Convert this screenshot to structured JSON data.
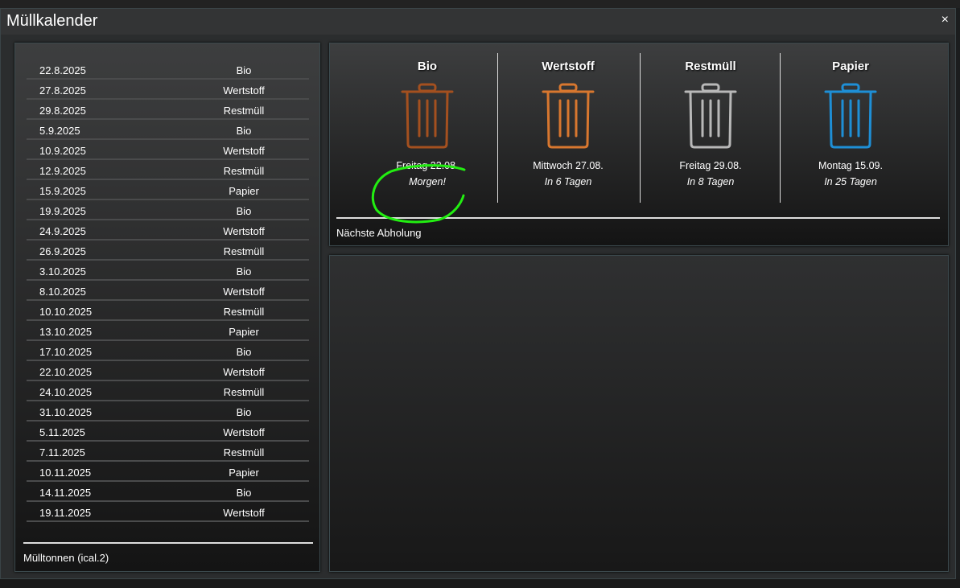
{
  "dialog": {
    "title": "Müllkalender",
    "close_label": "×"
  },
  "list": {
    "rows": [
      {
        "date": "22.8.2025",
        "type": "Bio"
      },
      {
        "date": "27.8.2025",
        "type": "Wertstoff"
      },
      {
        "date": "29.8.2025",
        "type": "Restmüll"
      },
      {
        "date": "5.9.2025",
        "type": "Bio"
      },
      {
        "date": "10.9.2025",
        "type": "Wertstoff"
      },
      {
        "date": "12.9.2025",
        "type": "Restmüll"
      },
      {
        "date": "15.9.2025",
        "type": "Papier"
      },
      {
        "date": "19.9.2025",
        "type": "Bio"
      },
      {
        "date": "24.9.2025",
        "type": "Wertstoff"
      },
      {
        "date": "26.9.2025",
        "type": "Restmüll"
      },
      {
        "date": "3.10.2025",
        "type": "Bio"
      },
      {
        "date": "8.10.2025",
        "type": "Wertstoff"
      },
      {
        "date": "10.10.2025",
        "type": "Restmüll"
      },
      {
        "date": "13.10.2025",
        "type": "Papier"
      },
      {
        "date": "17.10.2025",
        "type": "Bio"
      },
      {
        "date": "22.10.2025",
        "type": "Wertstoff"
      },
      {
        "date": "24.10.2025",
        "type": "Restmüll"
      },
      {
        "date": "31.10.2025",
        "type": "Bio"
      },
      {
        "date": "5.11.2025",
        "type": "Wertstoff"
      },
      {
        "date": "7.11.2025",
        "type": "Restmüll"
      },
      {
        "date": "10.11.2025",
        "type": "Papier"
      },
      {
        "date": "14.11.2025",
        "type": "Bio"
      },
      {
        "date": "19.11.2025",
        "type": "Wertstoff"
      }
    ],
    "footer": "Mülltonnen (ical.2)"
  },
  "next": {
    "bins": [
      {
        "name": "Bio",
        "date": "Freitag 22.08.",
        "relative": "Morgen!",
        "color": "#a4501f",
        "icon": "trash-bin-icon"
      },
      {
        "name": "Wertstoff",
        "date": "Mittwoch 27.08.",
        "relative": "In 6 Tagen",
        "color": "#d8772f",
        "icon": "trash-bin-icon"
      },
      {
        "name": "Restmüll",
        "date": "Freitag 29.08.",
        "relative": "In 8 Tagen",
        "color": "#b8b8b8",
        "icon": "trash-bin-icon"
      },
      {
        "name": "Papier",
        "date": "Montag 15.09.",
        "relative": "In 25 Tagen",
        "color": "#1e8fd6",
        "icon": "trash-bin-icon"
      }
    ],
    "footer": "Nächste Abholung",
    "annotation_color": "#22ee11"
  }
}
